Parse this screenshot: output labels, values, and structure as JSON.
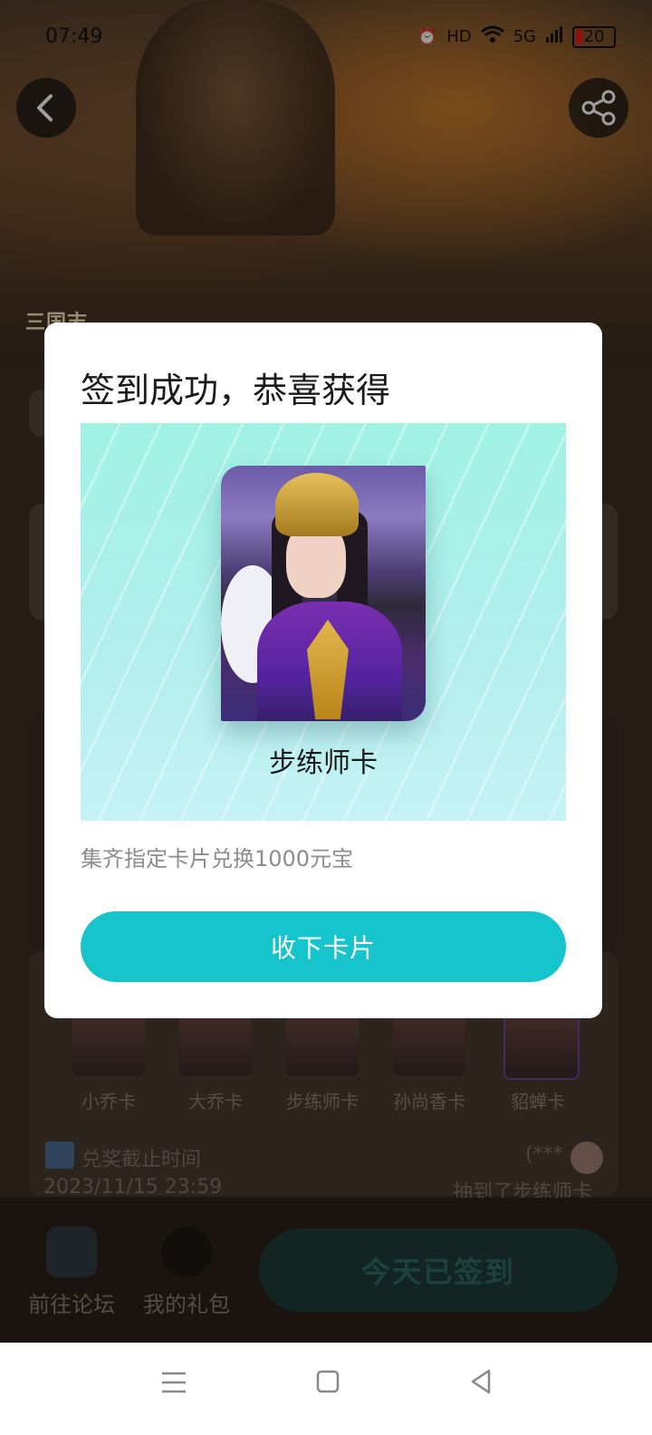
{
  "status_bar": {
    "time": "07:49",
    "battery": "20",
    "network": "5G"
  },
  "hero": {
    "game_logo": "三国志",
    "back_icon": "chevron-left-icon",
    "share_icon": "share-icon"
  },
  "cards_strip": [
    {
      "label": "小乔卡"
    },
    {
      "label": "大乔卡"
    },
    {
      "label": "步练师卡"
    },
    {
      "label": "孙尚香卡"
    },
    {
      "label": "貂蝉卡"
    }
  ],
  "deadline": {
    "label": "兑奖截止时间",
    "date": "2023/11/15 23:59"
  },
  "winner": {
    "name": "(***",
    "text": "抽到了步练师卡"
  },
  "bottom_bar": {
    "forum_label": "前往论坛",
    "gift_label": "我的礼包",
    "signed_label": "今天已签到"
  },
  "modal": {
    "title": "签到成功，恭喜获得",
    "card_name": "步练师卡",
    "description": "集齐指定卡片兑换1000元宝",
    "accept_label": "收下卡片"
  },
  "colors": {
    "accent": "#16c4cc",
    "panel_top": "#9ff2e3",
    "panel_bottom": "#c5f2f5",
    "signed_button": "#1d3c38"
  }
}
